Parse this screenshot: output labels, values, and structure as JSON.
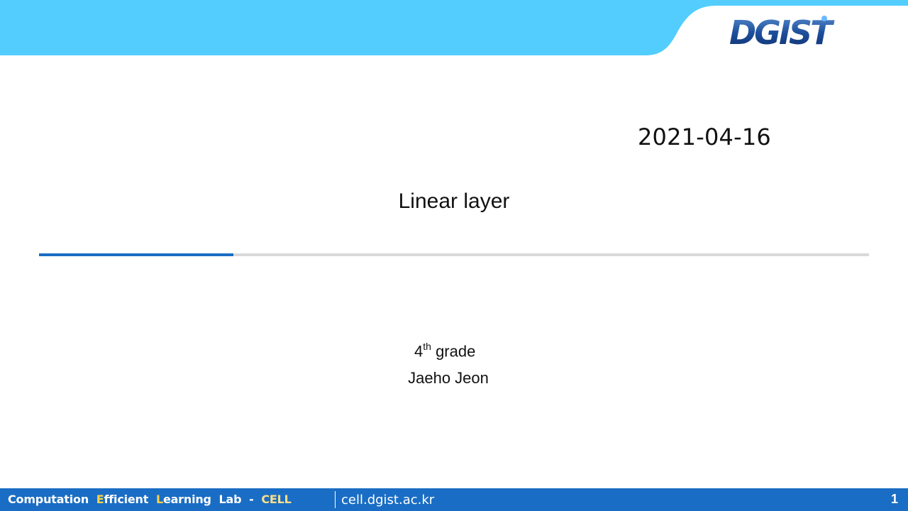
{
  "header": {
    "band_color": "#52cdfe",
    "logo_text": "DGIST"
  },
  "slide": {
    "date": "2021-04-16",
    "title": "Linear layer",
    "grade_number": "4",
    "grade_suffix": "th",
    "grade_word": "grade",
    "author": "Jaeho Jeon"
  },
  "footer": {
    "lab_words": [
      {
        "first": "C",
        "rest": "omputation"
      },
      {
        "first": "E",
        "rest": "fficient"
      },
      {
        "first": "L",
        "rest": "earning"
      },
      {
        "first": "",
        "rest": "Lab"
      }
    ],
    "lab_dash": "-",
    "lab_acronym": "CELL",
    "url": "cell.dgist.ac.kr",
    "page_number": "1",
    "bar_color": "#1a6dc4"
  }
}
